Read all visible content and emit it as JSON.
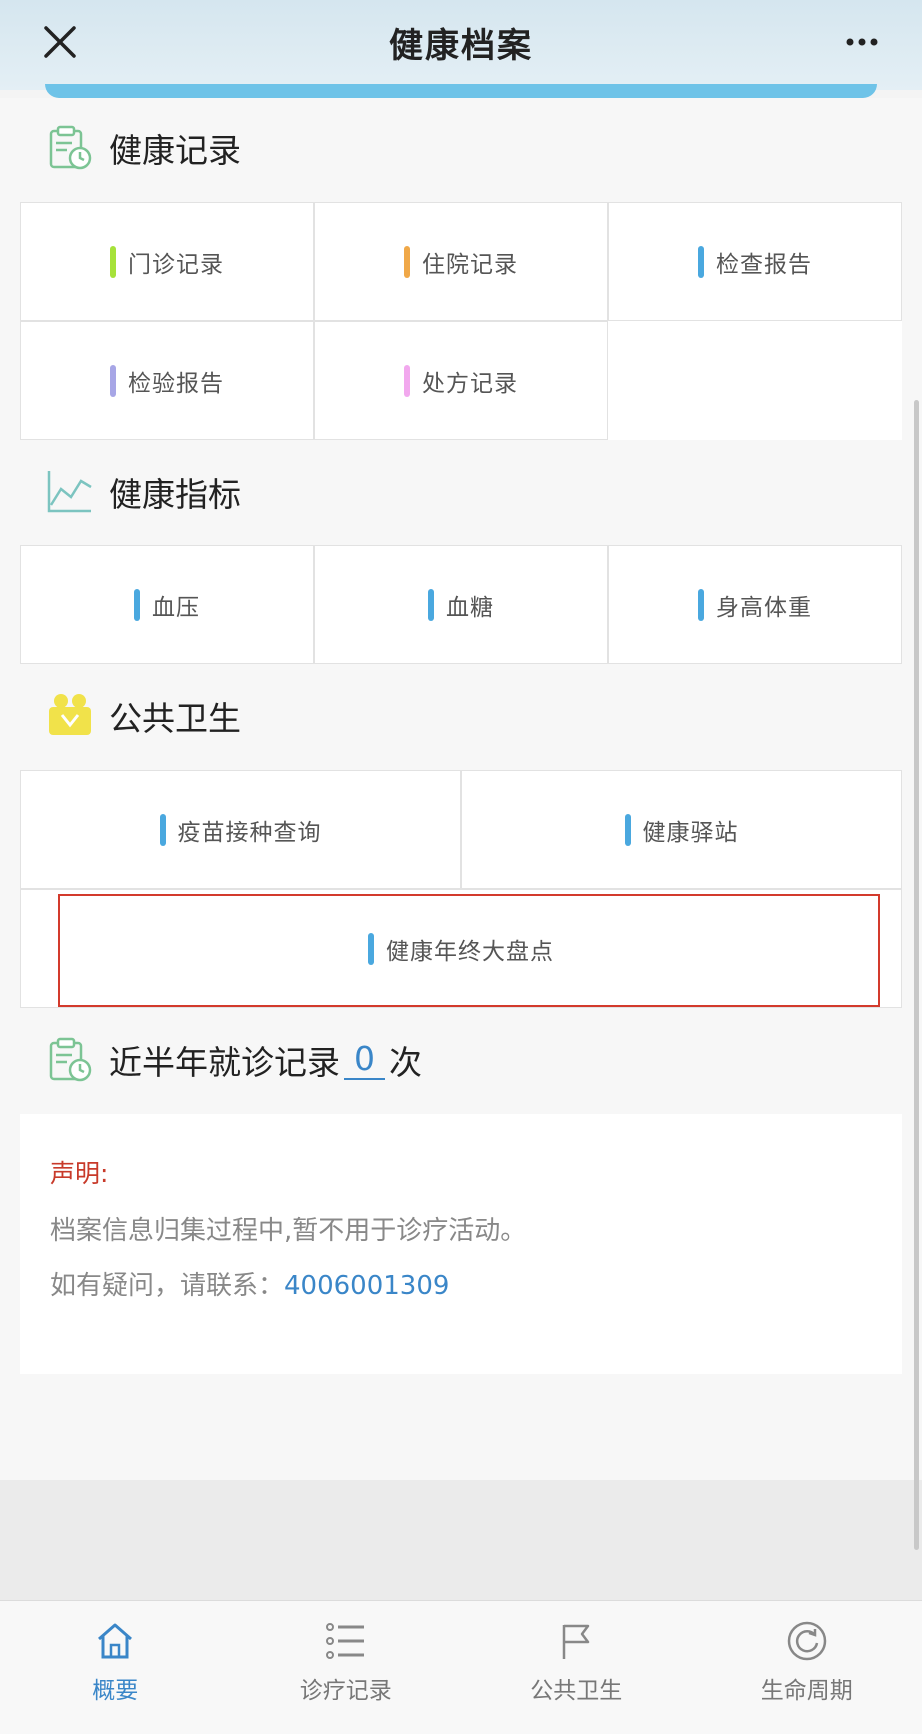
{
  "header": {
    "title": "健康档案"
  },
  "health_records": {
    "title": "健康记录",
    "items": [
      {
        "label": "门诊记录",
        "color": "#a6e23a"
      },
      {
        "label": "住院记录",
        "color": "#f0a848"
      },
      {
        "label": "检查报告",
        "color": "#4aa8df"
      },
      {
        "label": "检验报告",
        "color": "#a7a6e6"
      },
      {
        "label": "处方记录",
        "color": "#f2a8ee"
      }
    ]
  },
  "health_indicators": {
    "title": "健康指标",
    "items": [
      {
        "label": "血压",
        "color": "#4aa8df"
      },
      {
        "label": "血糖",
        "color": "#4aa8df"
      },
      {
        "label": "身高体重",
        "color": "#4aa8df"
      }
    ]
  },
  "public_health": {
    "title": "公共卫生",
    "items": [
      {
        "label": "疫苗接种查询",
        "color": "#4aa8df"
      },
      {
        "label": "健康驿站",
        "color": "#4aa8df"
      },
      {
        "label": "健康年终大盘点",
        "color": "#4aa8df"
      }
    ]
  },
  "visits": {
    "prefix": "近半年就诊记录",
    "count": "0",
    "suffix": "次"
  },
  "notice": {
    "title": "声明:",
    "line1": "档案信息归集过程中,暂不用于诊疗活动。",
    "line2_prefix": "如有疑问，请联系：",
    "phone": "4006001309"
  },
  "tabbar": {
    "items": [
      {
        "label": "概要",
        "icon": "home-icon",
        "active": true
      },
      {
        "label": "诊疗记录",
        "icon": "list-icon",
        "active": false
      },
      {
        "label": "公共卫生",
        "icon": "flag-icon",
        "active": false
      },
      {
        "label": "生命周期",
        "icon": "refresh-icon",
        "active": false
      }
    ]
  }
}
